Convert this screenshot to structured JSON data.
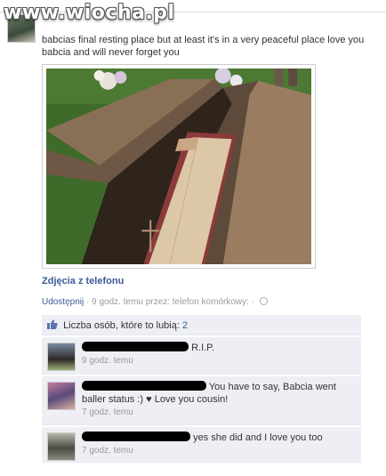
{
  "watermark": "www.wiocha.pl",
  "post": {
    "text": "babcias final resting place but at least it's in a very peaceful place love you babcia and will never forget you",
    "photo_caption": "Zdjęcia z telefonu",
    "share_label": "Udostępnij",
    "meta": "· 9 godz. temu przez: telefon komórkowy: ·"
  },
  "likes": {
    "label": "Liczba osób, które to lubią:",
    "count": "2"
  },
  "comments": [
    {
      "text": "R.I.P.",
      "time": "9 godz. temu"
    },
    {
      "text_line1": "You have to say, Babcia went",
      "text_line2": "baller status :) ♥ Love you cousin!",
      "time": "7 godz. temu"
    },
    {
      "text": "yes she did and I love you too",
      "time": "7 godz. temu"
    }
  ],
  "colors": {
    "link": "#3b5998",
    "comment_bg": "#edeff4",
    "meta_gray": "#999999"
  }
}
